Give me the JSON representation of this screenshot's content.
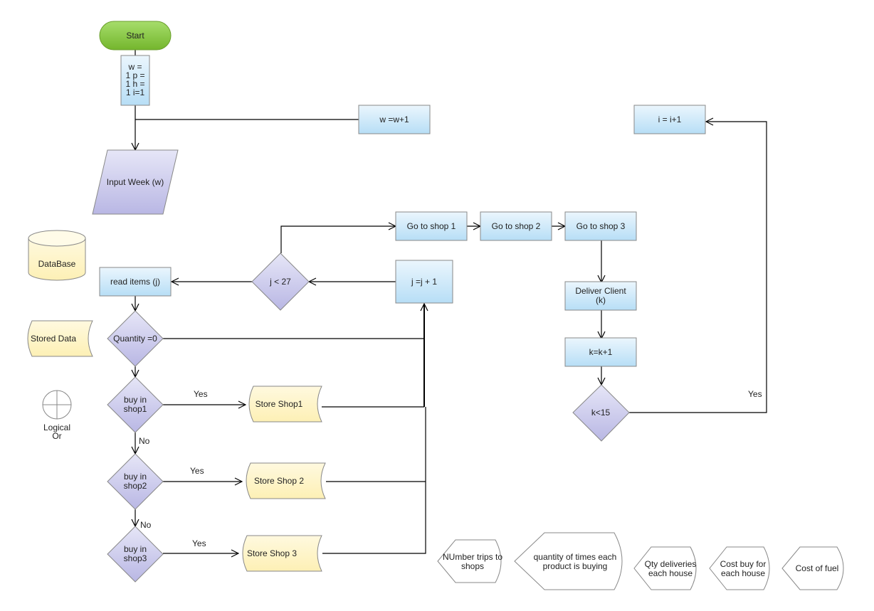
{
  "diagram": {
    "colors": {
      "terminator_top": "#a6dd6b",
      "terminator_bottom": "#74b62d",
      "process_top": "#ebf6fd",
      "process_bottom": "#b7def6",
      "decision_top": "#e6e6f7",
      "decision_bottom": "#b9b7e4",
      "storage_top": "#fff9df",
      "storage_bottom": "#fdf0b5",
      "stroke": "#888888",
      "line": "#000000"
    },
    "nodes": {
      "start": "Start",
      "init": [
        "w =",
        "1 p =",
        "1 h =",
        "1 i=1"
      ],
      "w_increment": "w =w+1",
      "i_increment": "i = i+1",
      "input_week": "Input Week (w)",
      "database": "DataBase",
      "read_items": "read items (j)",
      "j_check": "j < 27",
      "j_increment": "j =j + 1",
      "go_shop_1": "Go to shop 1",
      "go_shop_2": "Go to shop 2",
      "go_shop_3": "Go to shop 3",
      "deliver_client": [
        "Deliver Client",
        "(k)"
      ],
      "k_increment": "k=k+1",
      "k_check": "k<15",
      "stored_data": "Stored Data",
      "quantity_check": "Quantity =0",
      "buy_shop1": [
        "buy in",
        "shop1"
      ],
      "buy_shop2": [
        "buy in",
        "shop2"
      ],
      "buy_shop3": [
        "buy in",
        "shop3"
      ],
      "store_shop1": "Store Shop1",
      "store_shop2": "Store Shop 2",
      "store_shop3": "Store Shop 3",
      "logical_or": [
        "Logical",
        "Or"
      ],
      "display_trips": [
        "NUmber trips to",
        "shops"
      ],
      "display_quantity": [
        "quantity of times each",
        "product is buying"
      ],
      "display_qty_deliveries": [
        "Qty deliveries",
        "each house"
      ],
      "display_cost_buy": [
        "Cost buy for",
        "each house"
      ],
      "display_cost_fuel": "Cost of fuel"
    },
    "edge_labels": {
      "shop1_yes": "Yes",
      "shop1_no": "No",
      "shop2_yes": "Yes",
      "shop2_no": "No",
      "shop3_yes": "Yes",
      "k_yes": "Yes"
    }
  }
}
